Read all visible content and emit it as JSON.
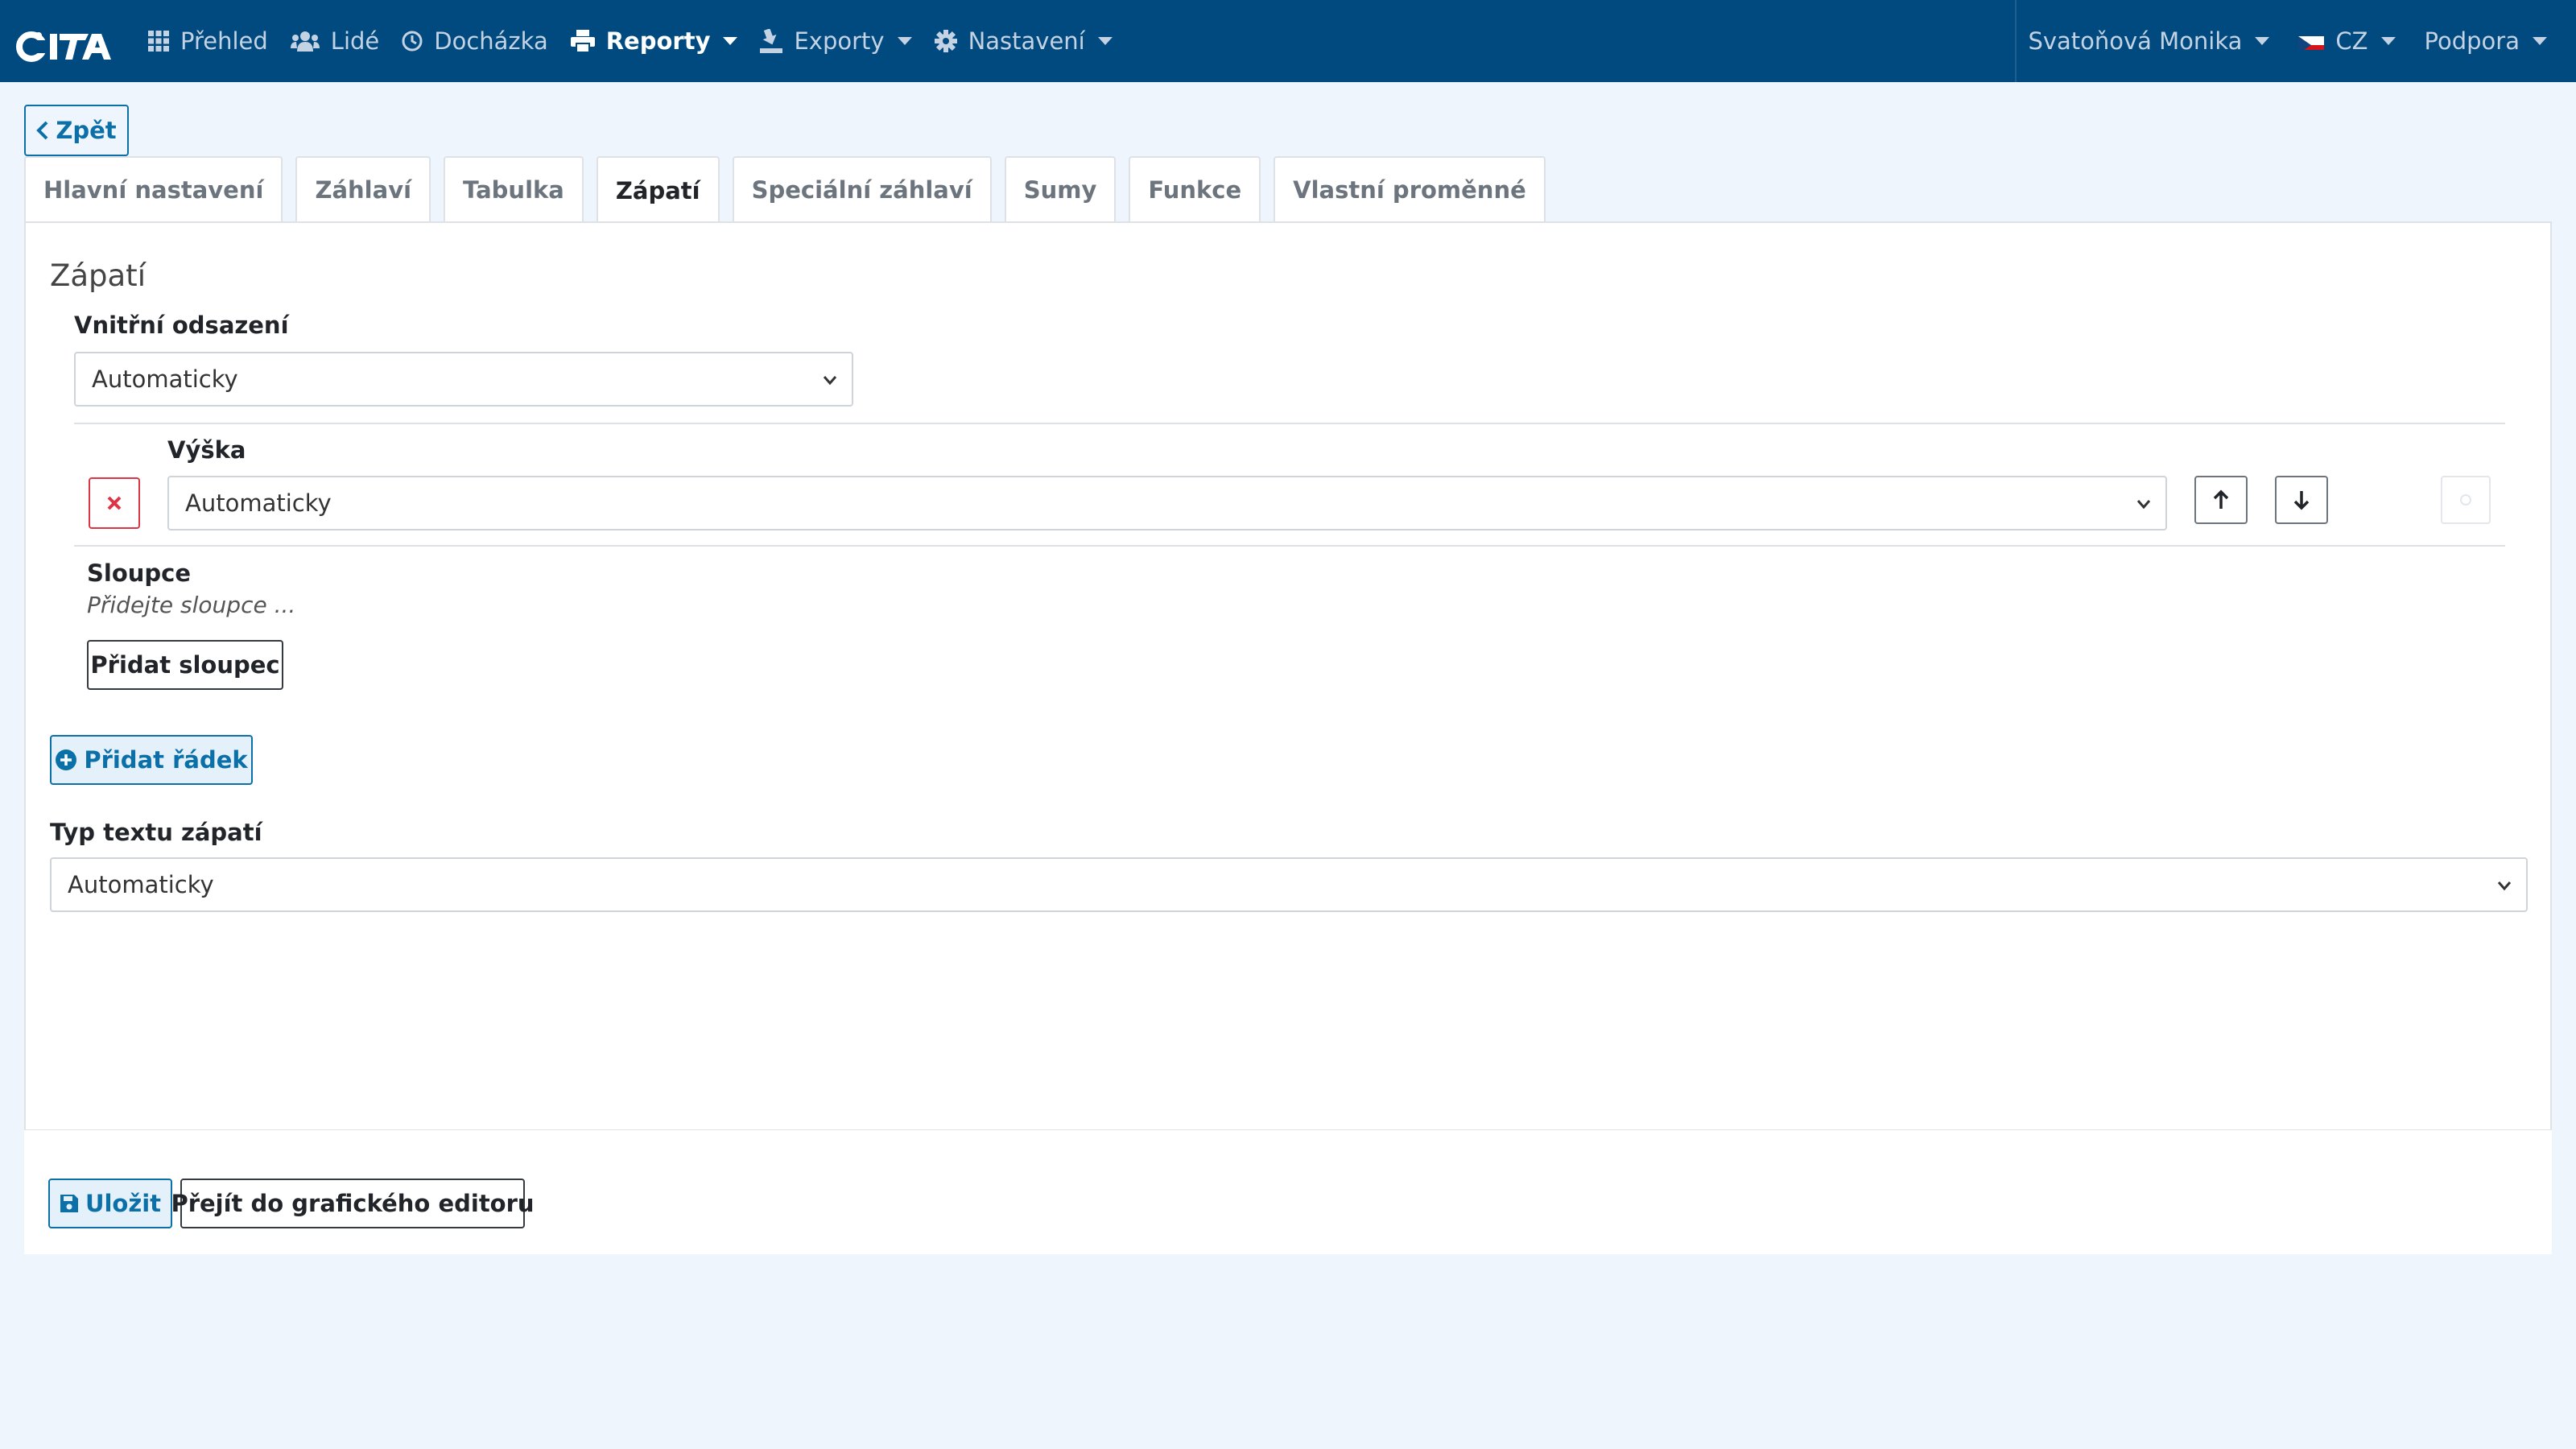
{
  "colors": {
    "navbar_bg": "#004a80",
    "page_bg": "#eff5fc",
    "primary": "#0b6fa8",
    "danger": "#dc3545"
  },
  "navbar": {
    "logo_text": "CiTA",
    "items": [
      {
        "label": "Přehled",
        "icon": "grid-icon"
      },
      {
        "label": "Lidé",
        "icon": "users-icon"
      },
      {
        "label": "Docházka",
        "icon": "clock-icon"
      },
      {
        "label": "Reporty",
        "icon": "print-icon",
        "active": true,
        "dropdown": true
      },
      {
        "label": "Exporty",
        "icon": "export-icon",
        "dropdown": true
      },
      {
        "label": "Nastavení",
        "icon": "gear-icon",
        "dropdown": true
      }
    ],
    "user": "Svatoňová Monika",
    "language": "CZ",
    "support": "Podpora"
  },
  "back_label": "Zpět",
  "tabs": [
    {
      "label": "Hlavní nastavení"
    },
    {
      "label": "Záhlaví"
    },
    {
      "label": "Tabulka"
    },
    {
      "label": "Zápatí",
      "active": true
    },
    {
      "label": "Speciální záhlaví"
    },
    {
      "label": "Sumy"
    },
    {
      "label": "Funkce"
    },
    {
      "label": "Vlastní proměnné"
    }
  ],
  "section": {
    "title": "Zápatí",
    "padding_label": "Vnitřní odsazení",
    "padding_value": "Automaticky",
    "row": {
      "height_label": "Výška",
      "height_value": "Automaticky",
      "columns_label": "Sloupce",
      "columns_hint": "Přidejte sloupce ...",
      "add_column_label": "Přidat sloupec"
    },
    "add_row_label": "Přidat řádek",
    "text_type_label": "Typ textu zápatí",
    "text_type_value": "Automaticky"
  },
  "actions": {
    "save_label": "Uložit",
    "editor_label": "Přejít do grafického editoru"
  }
}
